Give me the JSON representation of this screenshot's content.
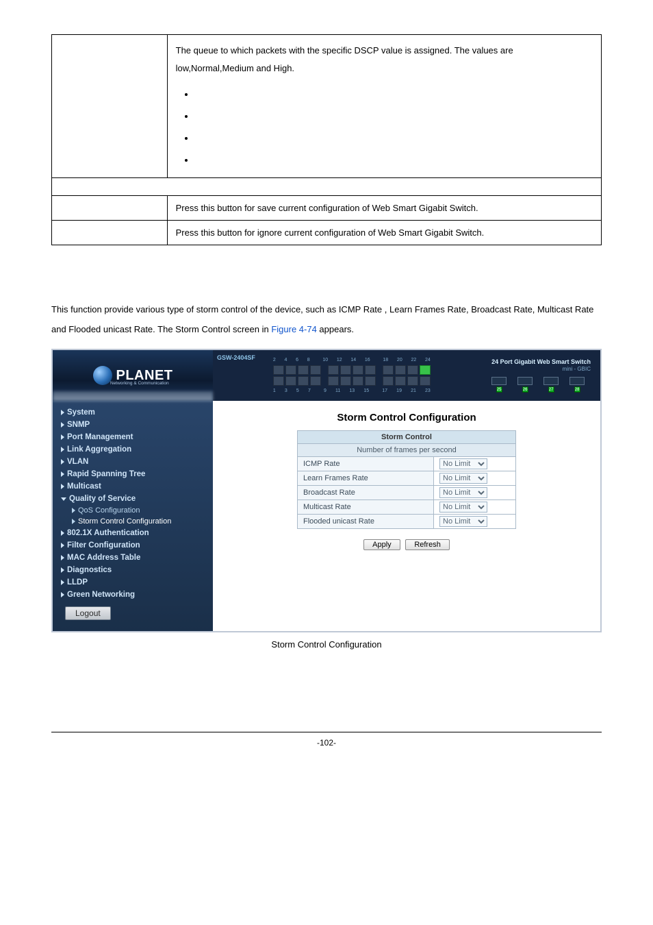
{
  "table": {
    "row1_desc": "The queue to which packets with the specific DSCP value is assigned. The values are low,Normal,Medium and High.",
    "row2_desc": "Press this button for save current configuration of Web Smart Gigabit Switch.",
    "row3_desc": "Press this button for ignore current configuration of Web Smart Gigabit Switch."
  },
  "section": {
    "body_a": "This function provide various type of storm control of the device, such as ICMP Rate , Learn Frames Rate, Broadcast Rate, Multicast Rate and Flooded unicast Rate. The Storm Control screen in ",
    "fig_ref": "Figure 4-74",
    "body_b": " appears."
  },
  "app": {
    "device": "GSW-2404SF",
    "logo": "PLANET",
    "logo_sub": "Networking & Communication",
    "right_title": "24 Port Gigabit Web Smart Switch",
    "right_sub": "mini - GBIC",
    "gbic": [
      "25",
      "26",
      "27",
      "28"
    ],
    "ports_top": [
      "2",
      "4",
      "6",
      "8",
      "10",
      "12",
      "14",
      "16",
      "18",
      "20",
      "22",
      "24"
    ],
    "ports_bot": [
      "1",
      "3",
      "5",
      "7",
      "9",
      "11",
      "13",
      "15",
      "17",
      "19",
      "21",
      "23"
    ]
  },
  "sidebar": {
    "items": [
      {
        "label": "System",
        "type": "closed"
      },
      {
        "label": "SNMP",
        "type": "closed"
      },
      {
        "label": "Port Management",
        "type": "closed"
      },
      {
        "label": "Link Aggregation",
        "type": "closed"
      },
      {
        "label": "VLAN",
        "type": "closed"
      },
      {
        "label": "Rapid Spanning Tree",
        "type": "closed"
      },
      {
        "label": "Multicast",
        "type": "closed"
      },
      {
        "label": "Quality of Service",
        "type": "open"
      },
      {
        "label": "QoS Configuration",
        "type": "sub"
      },
      {
        "label": "Storm Control Configuration",
        "type": "sub-active"
      },
      {
        "label": "802.1X Authentication",
        "type": "closed"
      },
      {
        "label": "Filter Configuration",
        "type": "closed"
      },
      {
        "label": "MAC Address Table",
        "type": "closed"
      },
      {
        "label": "Diagnostics",
        "type": "closed"
      },
      {
        "label": "LLDP",
        "type": "closed"
      },
      {
        "label": "Green Networking",
        "type": "closed"
      }
    ],
    "logout": "Logout"
  },
  "form": {
    "title": "Storm Control Configuration",
    "header1": "Storm Control",
    "header2": "Number of frames per second",
    "rows": [
      {
        "label": "ICMP Rate",
        "value": "No Limit"
      },
      {
        "label": "Learn Frames Rate",
        "value": "No Limit"
      },
      {
        "label": "Broadcast Rate",
        "value": "No Limit"
      },
      {
        "label": "Multicast Rate",
        "value": "No Limit"
      },
      {
        "label": "Flooded unicast Rate",
        "value": "No Limit"
      }
    ],
    "apply": "Apply",
    "refresh": "Refresh"
  },
  "caption": "Storm Control Configuration",
  "footer": "-102-"
}
